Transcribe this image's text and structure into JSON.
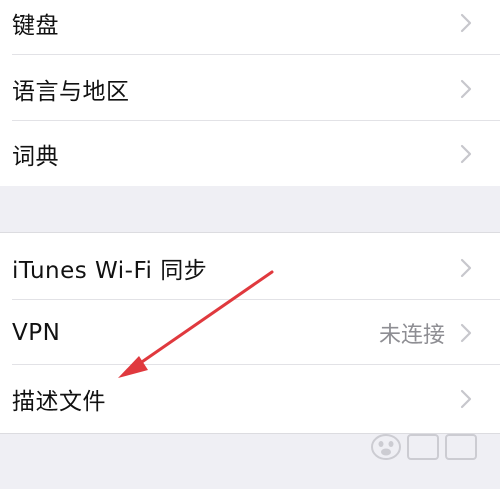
{
  "settings": {
    "group1": [
      {
        "label": "键盘"
      },
      {
        "label": "语言与地区"
      },
      {
        "label": "词典"
      }
    ],
    "group2": [
      {
        "label": "iTunes Wi-Fi 同步"
      },
      {
        "label": "VPN",
        "value": "未连接"
      },
      {
        "label": "描述文件"
      }
    ]
  },
  "colors": {
    "background": "#efeff4",
    "cell": "#ffffff",
    "text": "#111111",
    "secondary_text": "#8e8e93",
    "chevron": "#c7c7cc",
    "annotation_arrow": "#e0393e"
  },
  "icons": {
    "chevron": "chevron-right-icon",
    "annotation": "red-arrow-annotation",
    "watermark": "baidu-jingyan-watermark"
  }
}
